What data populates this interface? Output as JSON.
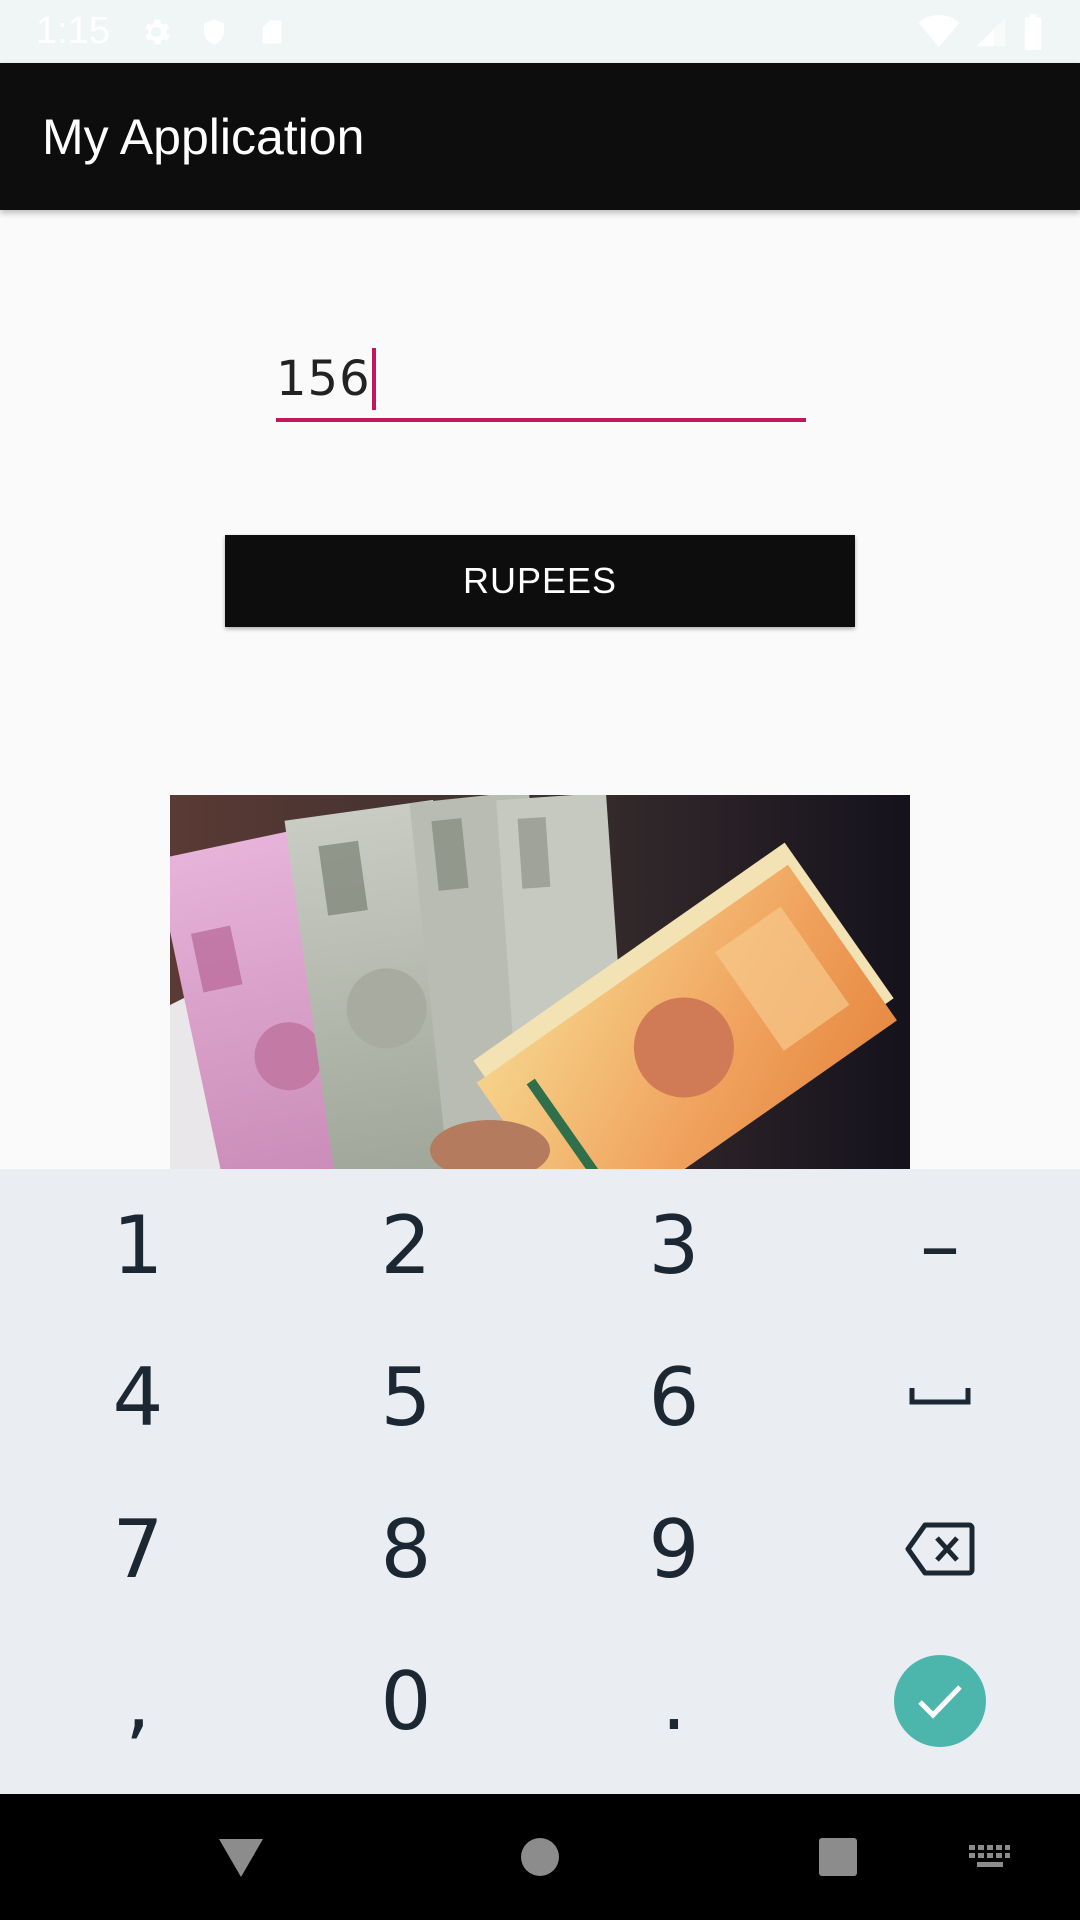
{
  "status_bar": {
    "time": "1:15",
    "left_icons": [
      "settings-icon",
      "shield-icon",
      "sd-card-icon"
    ],
    "right_icons": [
      "wifi-icon",
      "signal-icon",
      "battery-icon"
    ]
  },
  "app_bar": {
    "title": "My Application"
  },
  "amount_input": {
    "value": "156"
  },
  "convert_button": {
    "label": "RUPEES"
  },
  "keyboard": {
    "rows": [
      [
        "1",
        "2",
        "3",
        "–"
      ],
      [
        "4",
        "5",
        "6",
        "space"
      ],
      [
        "7",
        "8",
        "9",
        "backspace"
      ],
      [
        ",",
        "0",
        ".",
        "done"
      ]
    ],
    "done_color": "#4db6ac"
  },
  "nav_bar": {
    "buttons": [
      "back-icon",
      "home-icon",
      "recents-icon",
      "keyboard-switch-icon"
    ]
  },
  "colors": {
    "app_bar": "#0d0d0d",
    "accent": "#c2185b",
    "keyboard_bg": "#eaeef2"
  }
}
